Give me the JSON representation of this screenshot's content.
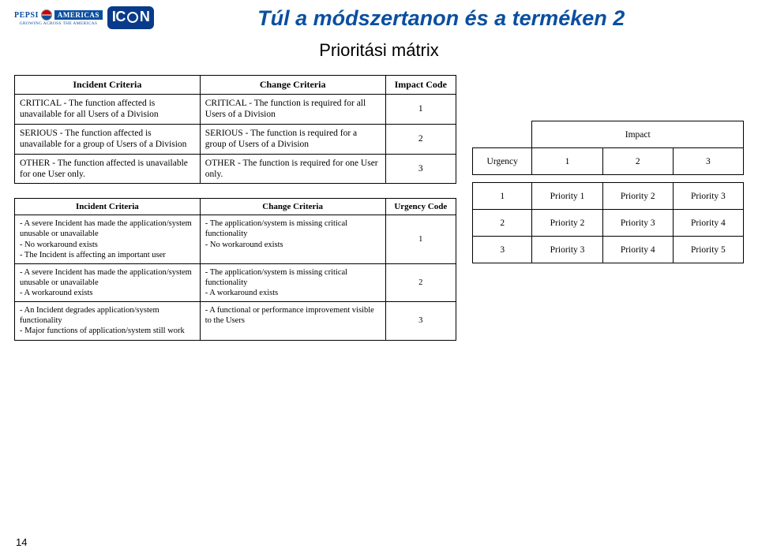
{
  "header": {
    "pepsi": "PEPSI",
    "americas": "AMERICAS",
    "pepsi_sub": "GROWING ACROSS THE AMERICAS",
    "icon": "IC",
    "icon2": "N"
  },
  "title": "Túl a módszertanon és a terméken 2",
  "subtitle": "Prioritási mátrix",
  "table1": {
    "head": {
      "c1": "Incident Criteria",
      "c2": "Change Criteria",
      "c3": "Impact Code"
    },
    "rows": [
      {
        "c1": "CRITICAL - The function affected is unavailable for all Users of a Division",
        "c2": "CRITICAL - The function is required for all Users of a Division",
        "c3": "1"
      },
      {
        "c1": "SERIOUS - The function affected is unavailable for a group of Users of a Division",
        "c2": "SERIOUS - The function is required for a group of Users of a Division",
        "c3": "2"
      },
      {
        "c1": "OTHER - The function affected is unavailable for one User only.",
        "c2": "OTHER - The function is required for one User only.",
        "c3": "3"
      }
    ]
  },
  "table2": {
    "head": {
      "c1": "Incident Criteria",
      "c2": "Change Criteria",
      "c3": "Urgency Code"
    },
    "rows": [
      {
        "c1": "- A severe Incident has made the application/system unusable or unavailable\n- No workaround exists\n- The Incident is affecting an important user",
        "c2": "- The application/system is missing critical functionality\n- No workaround exists",
        "c3": "1"
      },
      {
        "c1": "- A severe Incident has made the application/system unusable or unavailable\n- A workaround exists",
        "c2": "- The application/system is missing critical functionality\n- A workaround exists",
        "c3": "2"
      },
      {
        "c1": "- An Incident degrades application/system functionality\n- Major functions of application/system still work",
        "c2": "- A functional or performance improvement visible to the Users",
        "c3": "3"
      }
    ]
  },
  "matrix": {
    "impact_label": "Impact",
    "urgency_label": "Urgency",
    "cols": [
      "1",
      "2",
      "3"
    ],
    "rows": [
      "1",
      "2",
      "3"
    ],
    "cells": [
      [
        "Priority 1",
        "Priority 2",
        "Priority 3"
      ],
      [
        "Priority 2",
        "Priority 3",
        "Priority 4"
      ],
      [
        "Priority 3",
        "Priority 4",
        "Priority 5"
      ]
    ]
  },
  "page_number": "14"
}
